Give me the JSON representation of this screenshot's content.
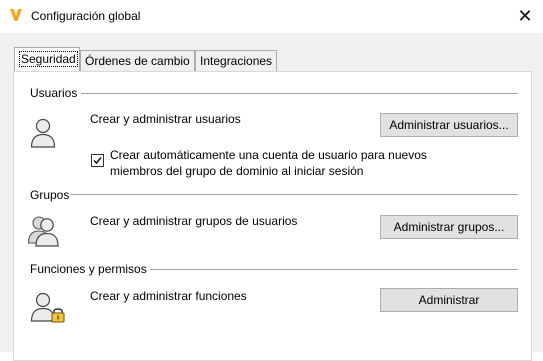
{
  "window": {
    "title": "Configuración global",
    "close_glyph": "✕",
    "app_icon": "vault-v-icon"
  },
  "tabs": [
    {
      "label": "Seguridad",
      "active": true
    },
    {
      "label": "Órdenes de cambio",
      "active": false
    },
    {
      "label": "Integraciones",
      "active": false
    }
  ],
  "sections": {
    "users": {
      "title": "Usuarios",
      "description": "Crear y administrar usuarios",
      "button": "Administrar usuarios...",
      "icon": "user-icon",
      "checkbox": {
        "checked": true,
        "label": "Crear automáticamente una cuenta de usuario para nuevos miembros del grupo de dominio al iniciar sesión"
      }
    },
    "groups": {
      "title": "Grupos",
      "description": "Crear y administrar grupos de usuarios",
      "button": "Administrar grupos...",
      "icon": "user-group-icon"
    },
    "roles": {
      "title": "Funciones y permisos",
      "description": "Crear y administrar funciones",
      "button": "Administrar",
      "icon": "user-lock-icon"
    }
  },
  "colors": {
    "app_icon_accent": "#f5a623",
    "dialog_background": "#f0f0f0",
    "button_face": "#e1e1e1"
  }
}
